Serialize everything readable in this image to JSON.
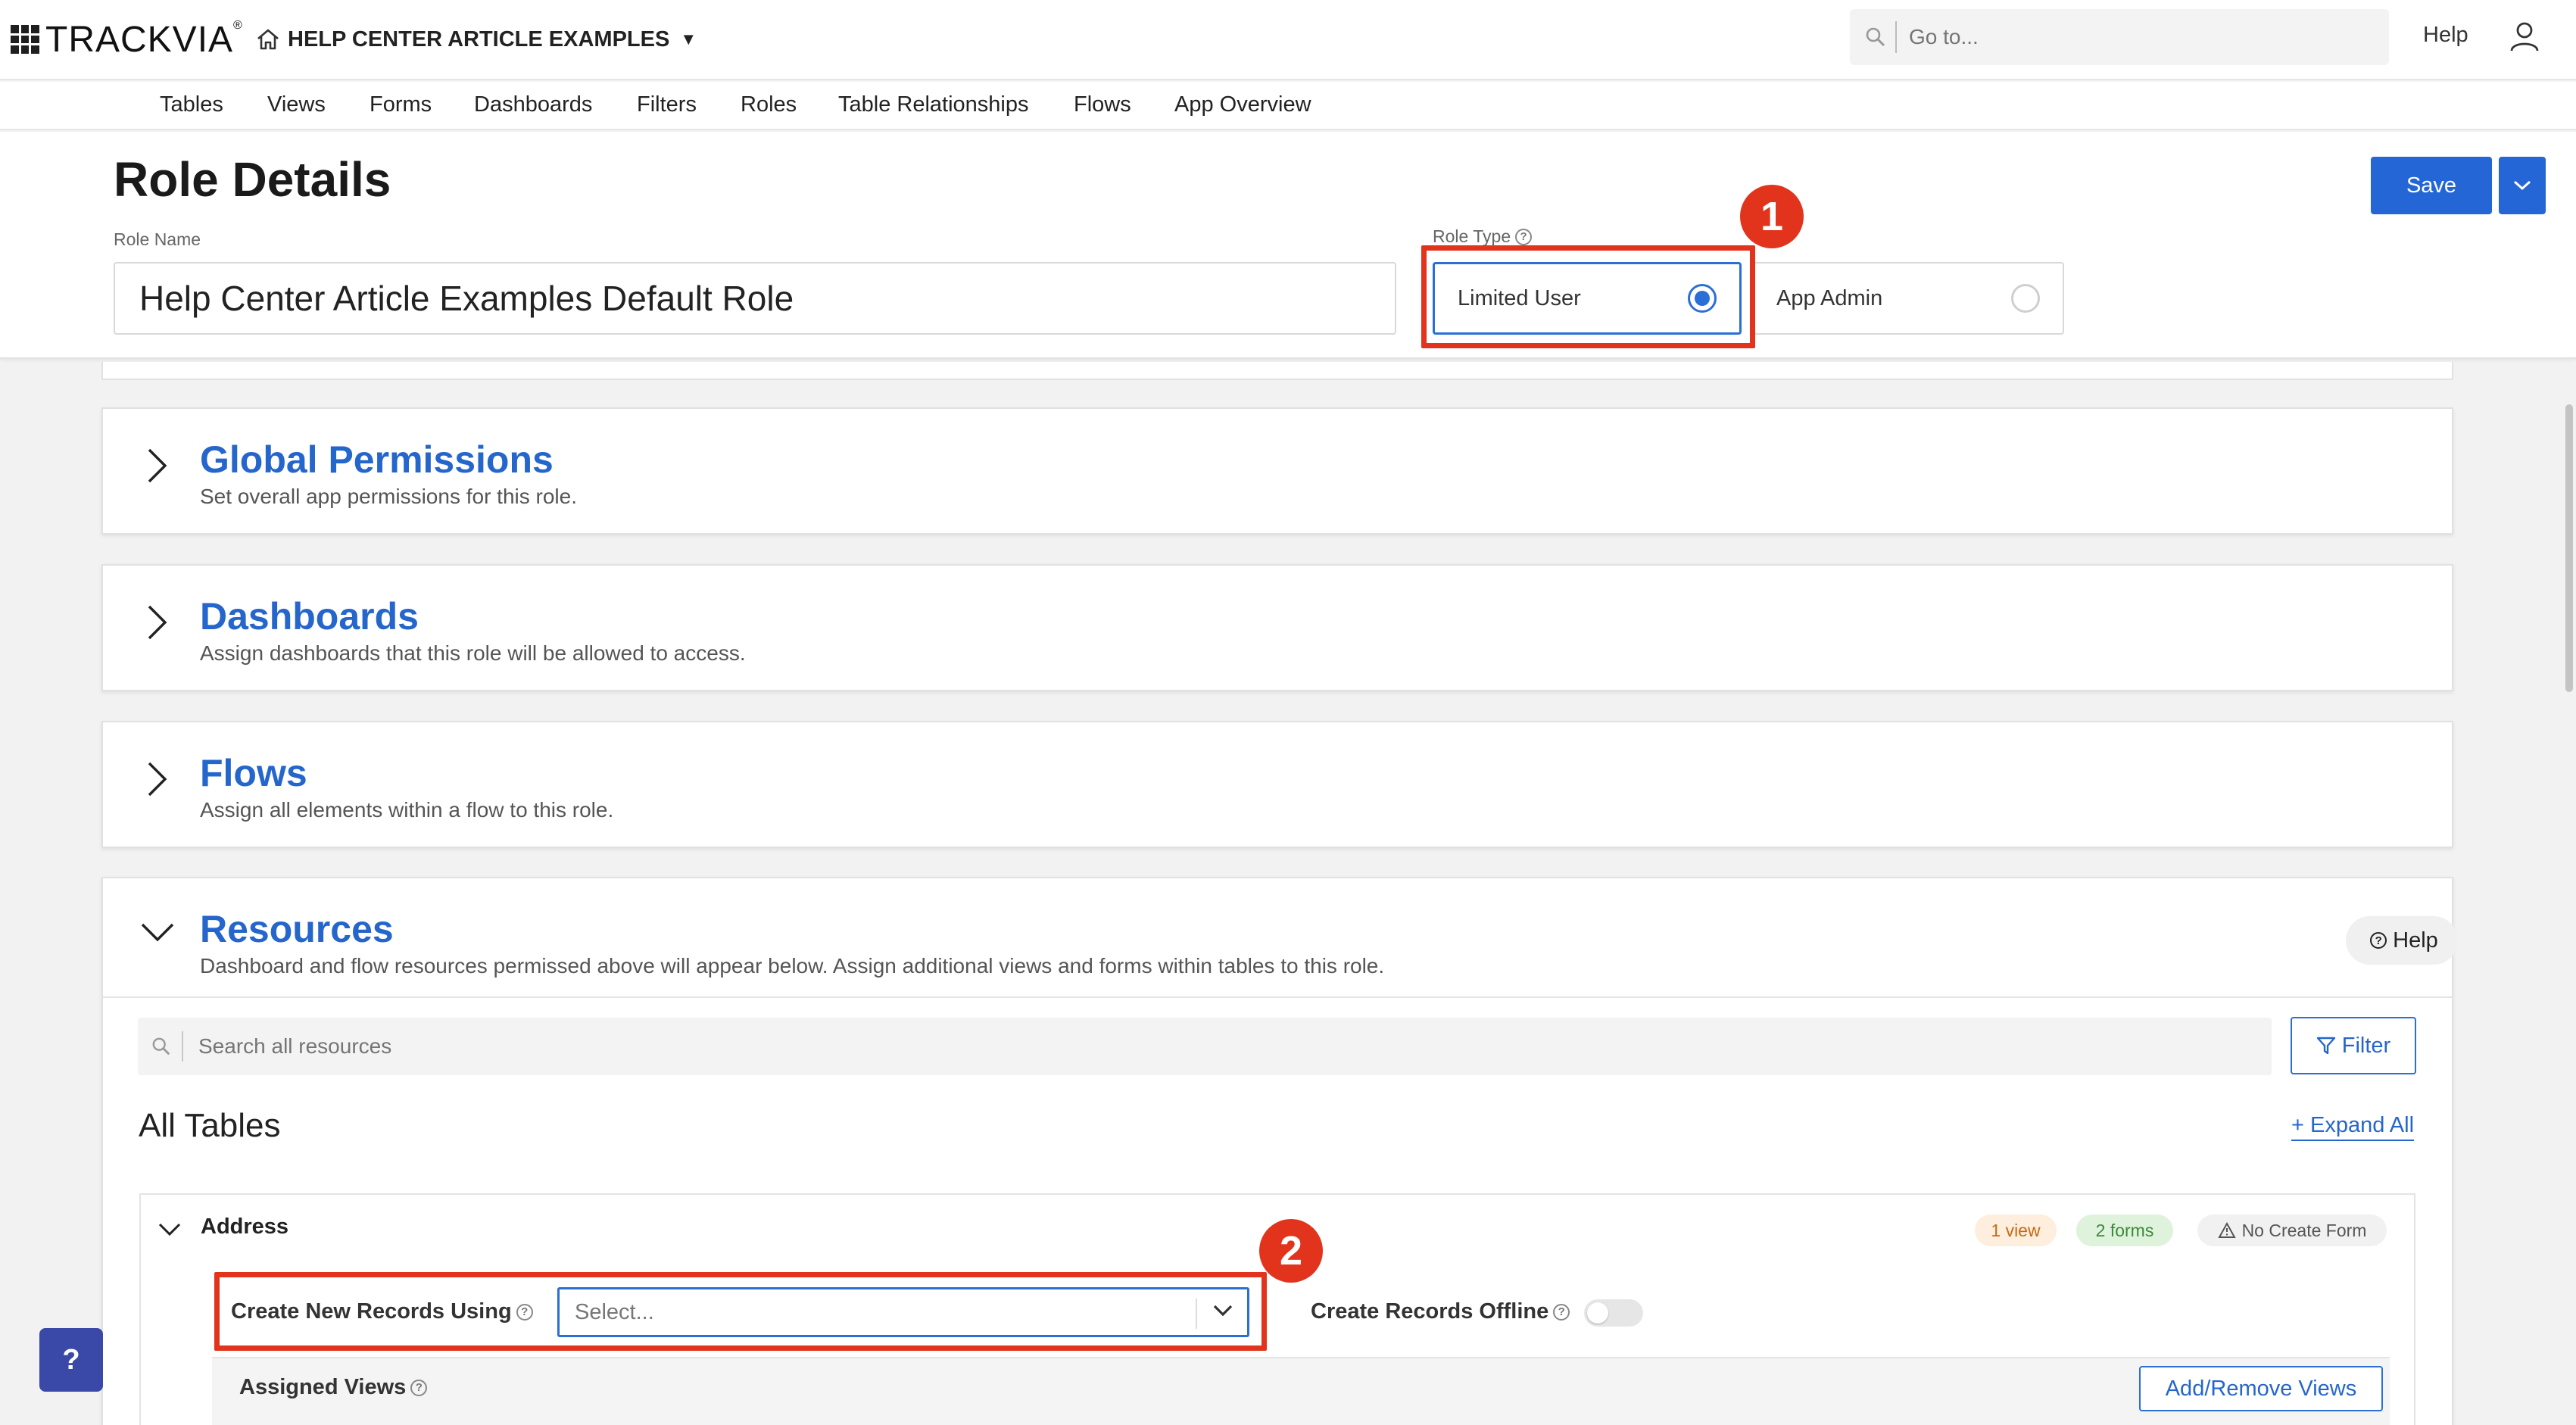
{
  "brand": {
    "logo_text": "TRACKVIA",
    "trademark": "®"
  },
  "header": {
    "app_name": "HELP CENTER ARTICLE EXAMPLES",
    "goto_placeholder": "Go to...",
    "help_label": "Help",
    "icons": [
      "home-icon",
      "search-icon",
      "user-icon",
      "caret-down-icon"
    ]
  },
  "nav": {
    "items": [
      "Tables",
      "Views",
      "Forms",
      "Dashboards",
      "Filters",
      "Roles",
      "Table Relationships",
      "Flows",
      "App Overview"
    ]
  },
  "role": {
    "title": "Role Details",
    "name_label": "Role Name",
    "name_value": "Help Center Article Examples Default Role",
    "type_label": "Role Type",
    "types": [
      {
        "label": "Limited User",
        "selected": true
      },
      {
        "label": "App Admin",
        "selected": false
      }
    ],
    "save_label": "Save"
  },
  "annotations": {
    "one": "1",
    "two": "2",
    "color": "#e2341d"
  },
  "sections": [
    {
      "title": "Global Permissions",
      "desc": "Set overall app permissions for this role.",
      "expanded": false
    },
    {
      "title": "Dashboards",
      "desc": "Assign dashboards that this role will be allowed to access.",
      "expanded": false
    },
    {
      "title": "Flows",
      "desc": "Assign all elements within a flow to this role.",
      "expanded": false
    },
    {
      "title": "Resources",
      "desc": "Dashboard and flow resources permissed above will appear below. Assign additional views and forms within tables to this role.",
      "expanded": true
    }
  ],
  "resources": {
    "help_label": "Help",
    "search_placeholder": "Search all resources",
    "filter_label": "Filter",
    "all_tables_label": "All Tables",
    "expand_all_label": "+ Expand All",
    "table": {
      "name": "Address",
      "badges": {
        "views": "1 view",
        "forms": "2 forms",
        "no_create": "No Create Form"
      },
      "create_label": "Create New Records Using",
      "select_placeholder": "Select...",
      "offline_label": "Create Records Offline",
      "offline_enabled": false,
      "assigned_views_label": "Assigned Views",
      "add_remove_label": "Add/Remove Views"
    }
  },
  "fab_label": "?",
  "colors": {
    "accent": "#2466d6",
    "link": "#2566cc",
    "highlight": "#e2341d"
  }
}
